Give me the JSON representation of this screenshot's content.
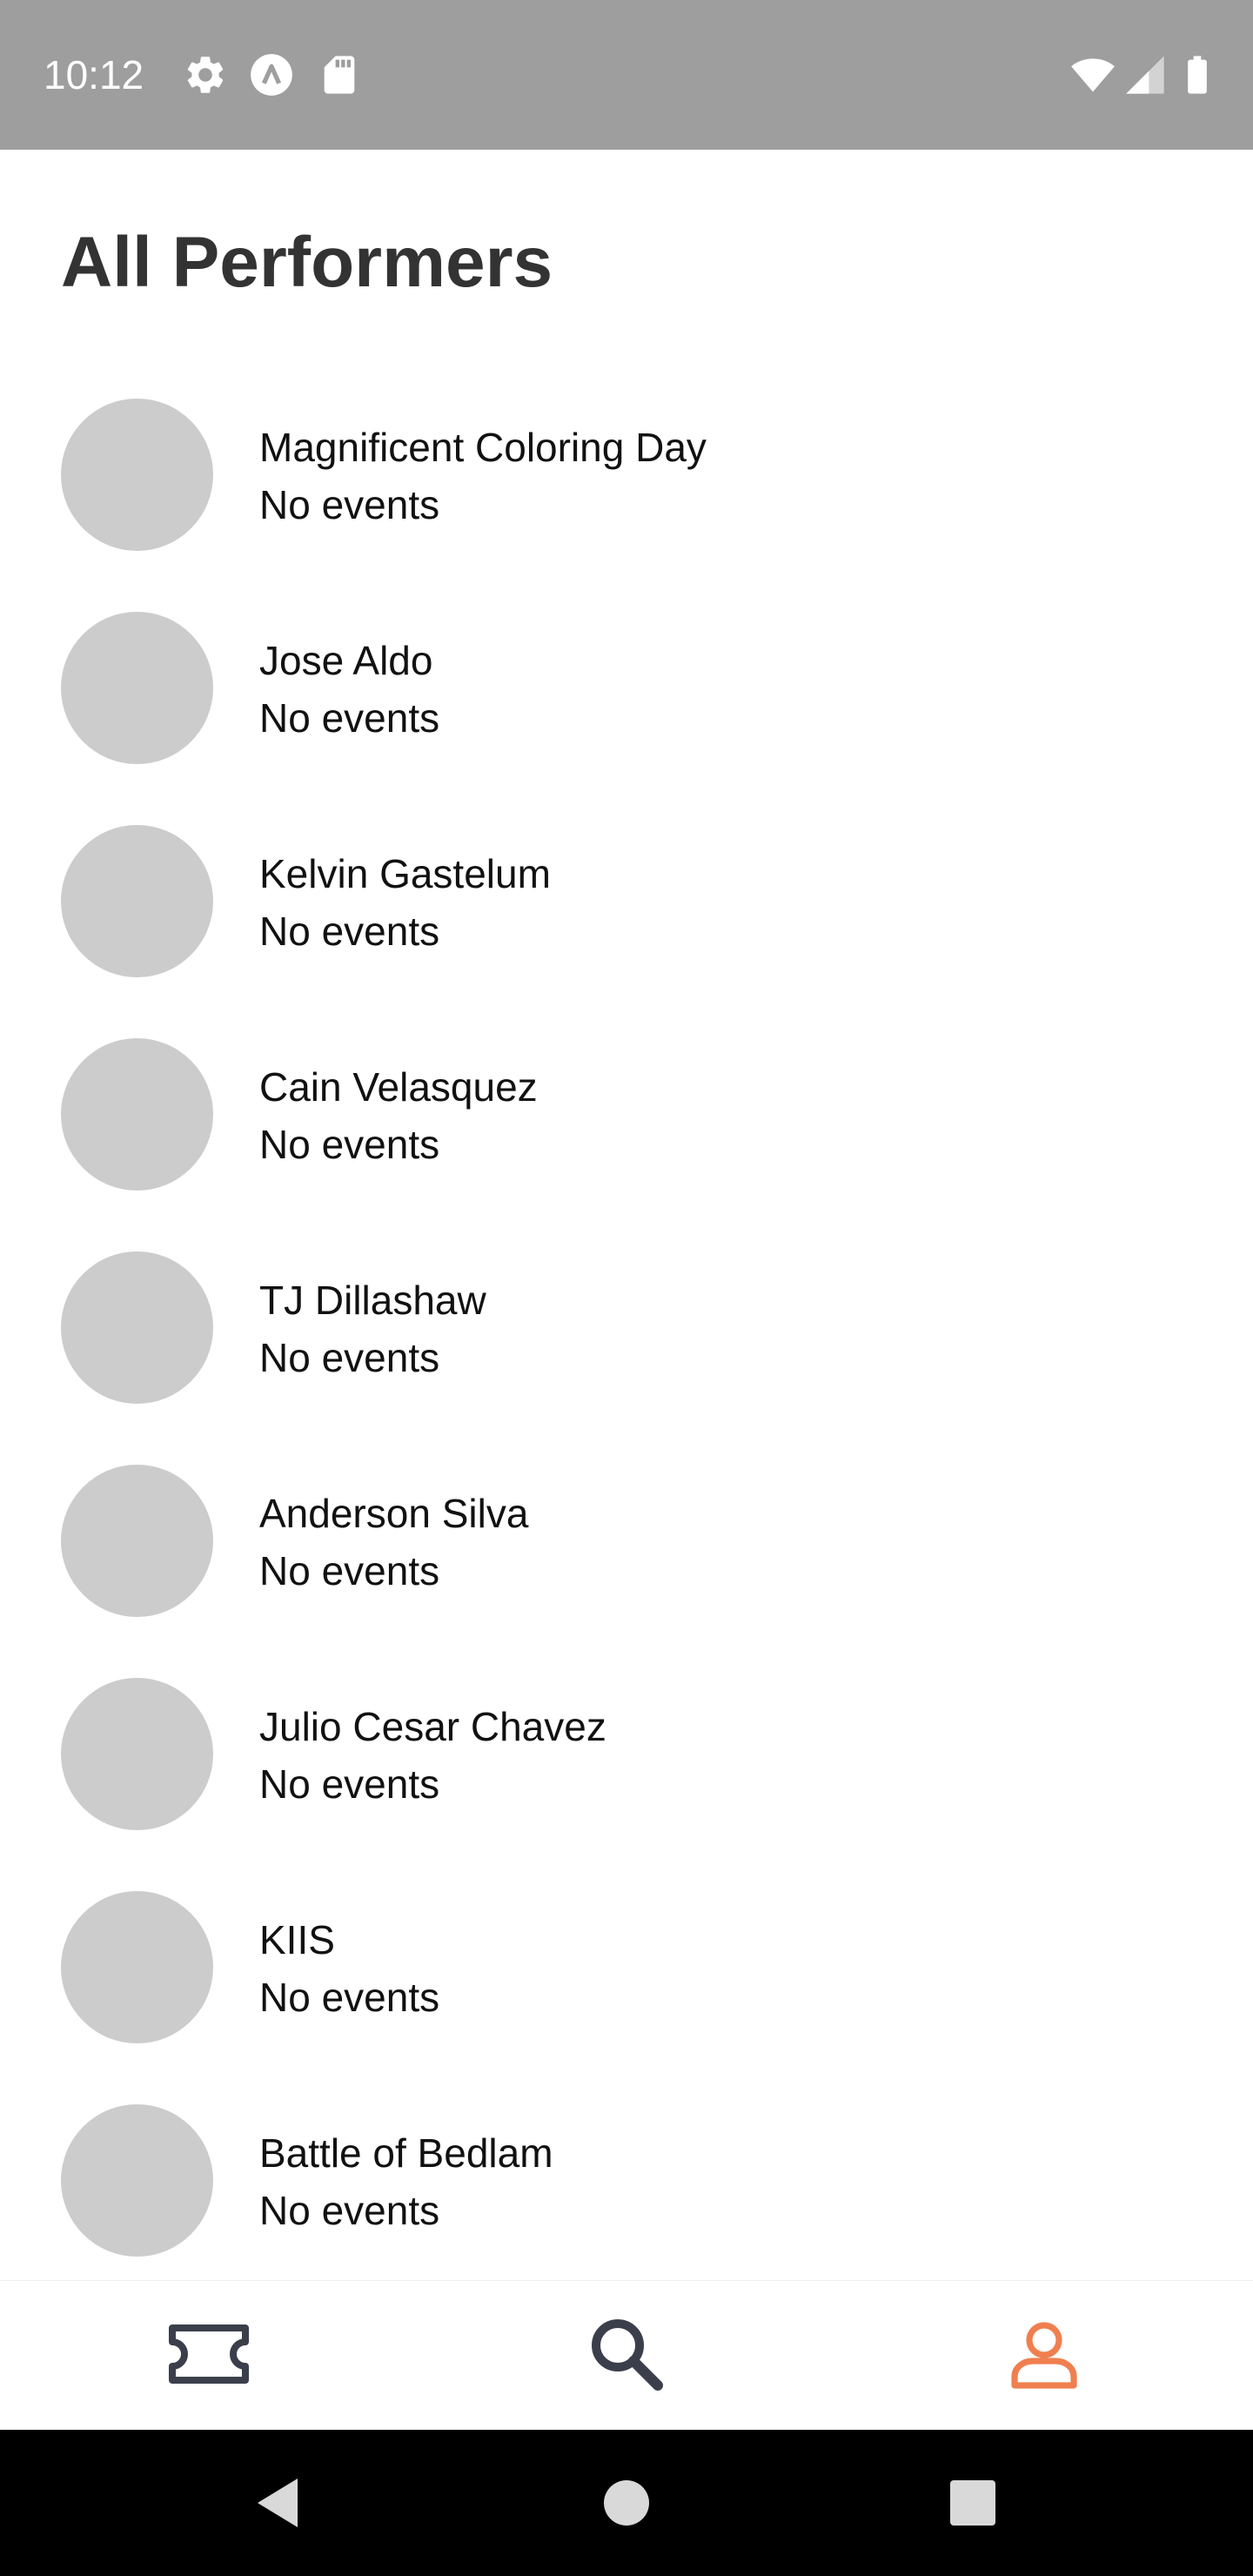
{
  "status_bar": {
    "time": "10:12",
    "left_icons": [
      "gear-icon",
      "app-notification-icon",
      "sd-card-icon"
    ],
    "right_icons": [
      "wifi-icon",
      "signal-icon",
      "battery-icon"
    ]
  },
  "page": {
    "title": "All Performers"
  },
  "performers": [
    {
      "name": "Magnificent Coloring Day",
      "events": "No events"
    },
    {
      "name": "Jose Aldo",
      "events": "No events"
    },
    {
      "name": "Kelvin Gastelum",
      "events": "No events"
    },
    {
      "name": "Cain Velasquez",
      "events": "No events"
    },
    {
      "name": "TJ Dillashaw",
      "events": "No events"
    },
    {
      "name": "Anderson Silva",
      "events": "No events"
    },
    {
      "name": "Julio Cesar Chavez",
      "events": "No events"
    },
    {
      "name": "KIIS",
      "events": "No events"
    },
    {
      "name": "Battle of Bedlam",
      "events": "No events"
    }
  ],
  "bottom_nav": {
    "tabs": [
      {
        "icon": "ticket-icon",
        "active": false
      },
      {
        "icon": "search-icon",
        "active": false
      },
      {
        "icon": "profile-icon",
        "active": true
      }
    ]
  },
  "colors": {
    "accent": "#f07f4f",
    "icon_default": "#3a3f4b",
    "avatar_placeholder": "#cccccc",
    "status_bar": "#9e9e9e"
  },
  "system_nav": {
    "buttons": [
      "back-icon",
      "home-icon",
      "recents-icon"
    ]
  }
}
